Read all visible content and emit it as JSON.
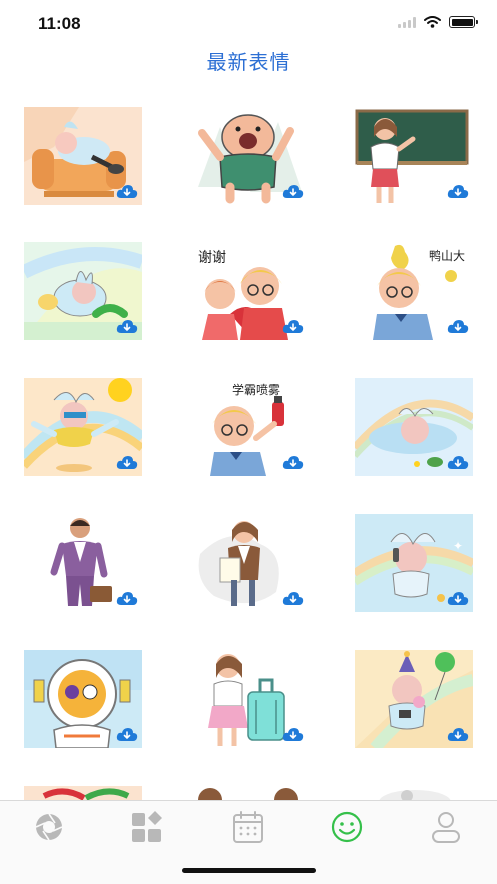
{
  "status_bar": {
    "time": "11:08",
    "battery_level": 1.0
  },
  "page": {
    "title": "最新表情"
  },
  "colors": {
    "title_blue": "#2c6fd4",
    "download_blue": "#1f7ad8",
    "tab_inactive": "#b8b8b8",
    "tab_active": "#35c04a"
  },
  "stickers": [
    {
      "id": "sticker-sleeping-bunny-sofa",
      "text": ""
    },
    {
      "id": "sticker-monster-tree",
      "text": ""
    },
    {
      "id": "sticker-teacher-blackboard",
      "text": ""
    },
    {
      "id": "sticker-bunny-caterpillar",
      "text": ""
    },
    {
      "id": "sticker-couple-heart",
      "text": "谢谢"
    },
    {
      "id": "sticker-boy-pear",
      "text": "鸭山大"
    },
    {
      "id": "sticker-bunny-sun-jump",
      "text": ""
    },
    {
      "id": "sticker-boy-spray",
      "text": "学霸喷雾"
    },
    {
      "id": "sticker-bunny-splash-turtle",
      "text": ""
    },
    {
      "id": "sticker-businessman-briefcase",
      "text": ""
    },
    {
      "id": "sticker-woman-document",
      "text": ""
    },
    {
      "id": "sticker-bunny-headphones",
      "text": ""
    },
    {
      "id": "sticker-astronaut-cat",
      "text": ""
    },
    {
      "id": "sticker-woman-suitcase",
      "text": ""
    },
    {
      "id": "sticker-bunny-balloon-party",
      "text": ""
    },
    {
      "id": "sticker-partial-1",
      "text": ""
    },
    {
      "id": "sticker-partial-2",
      "text": ""
    },
    {
      "id": "sticker-partial-3",
      "text": ""
    }
  ],
  "tabs": [
    {
      "name": "camera-aperture-icon",
      "active": false
    },
    {
      "name": "categories-grid-icon",
      "active": false
    },
    {
      "name": "calendar-icon",
      "active": false
    },
    {
      "name": "smiley-face-icon",
      "active": true
    },
    {
      "name": "profile-person-icon",
      "active": false
    }
  ]
}
